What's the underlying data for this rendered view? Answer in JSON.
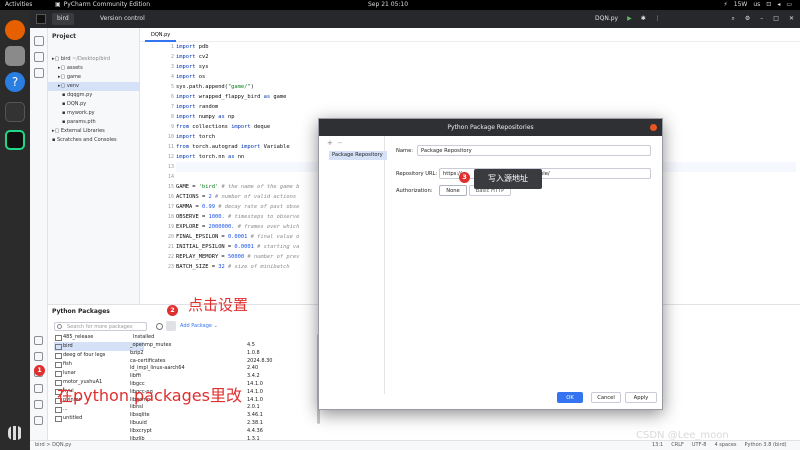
{
  "topbar": {
    "activities": "Activities",
    "app": "PyCharm Community Edition",
    "clock": "Sep 21  05:10",
    "temp": "15W",
    "lang": "us"
  },
  "titlebar": {
    "project": "bird",
    "vcs": "Version control",
    "run_config": "DQN.py"
  },
  "project": {
    "header": "Project",
    "items": [
      {
        "label": "bird",
        "dim": " ~/Desktop/bird",
        "indent": 4
      },
      {
        "label": "assets",
        "indent": 10
      },
      {
        "label": "game",
        "indent": 10
      },
      {
        "label": "venv",
        "indent": 10,
        "selected": true
      },
      {
        "label": "dqqgm.py",
        "indent": 14
      },
      {
        "label": "DQN.py",
        "indent": 14
      },
      {
        "label": "mywork.py",
        "indent": 14
      },
      {
        "label": "params.pth",
        "indent": 14
      },
      {
        "label": "External Libraries",
        "indent": 4
      },
      {
        "label": "Scratches and Consoles",
        "indent": 4
      }
    ]
  },
  "editor": {
    "tab": "DQN.py",
    "lines": [
      [
        {
          "t": "import",
          "c": "kw"
        },
        {
          "t": " pdb"
        }
      ],
      [
        {
          "t": "import",
          "c": "kw"
        },
        {
          "t": " cv2"
        }
      ],
      [
        {
          "t": "import",
          "c": "kw"
        },
        {
          "t": " sys"
        }
      ],
      [
        {
          "t": "import",
          "c": "kw"
        },
        {
          "t": " os"
        }
      ],
      [
        {
          "t": "sys.path.append("
        },
        {
          "t": "\"game/\"",
          "c": "str"
        },
        {
          "t": ")"
        }
      ],
      [
        {
          "t": "import",
          "c": "kw"
        },
        {
          "t": " wrapped_flappy_bird "
        },
        {
          "t": "as",
          "c": "kw"
        },
        {
          "t": " game"
        }
      ],
      [
        {
          "t": "import",
          "c": "kw"
        },
        {
          "t": " random"
        }
      ],
      [
        {
          "t": "import",
          "c": "kw"
        },
        {
          "t": " numpy "
        },
        {
          "t": "as",
          "c": "kw"
        },
        {
          "t": " np"
        }
      ],
      [
        {
          "t": "from",
          "c": "kw"
        },
        {
          "t": " collections "
        },
        {
          "t": "import",
          "c": "kw"
        },
        {
          "t": " deque"
        }
      ],
      [
        {
          "t": "import",
          "c": "kw"
        },
        {
          "t": " torch"
        }
      ],
      [
        {
          "t": "from",
          "c": "kw"
        },
        {
          "t": " torch.autograd "
        },
        {
          "t": "import",
          "c": "kw"
        },
        {
          "t": " Variable"
        }
      ],
      [
        {
          "t": "import",
          "c": "kw"
        },
        {
          "t": " torch.nn "
        },
        {
          "t": "as",
          "c": "kw"
        },
        {
          "t": " nn"
        }
      ],
      [],
      [],
      [
        {
          "t": "GAME = "
        },
        {
          "t": "'bird'",
          "c": "str"
        },
        {
          "t": " "
        },
        {
          "t": "# the name of the game b",
          "c": "cm"
        }
      ],
      [
        {
          "t": "ACTIONS = "
        },
        {
          "t": "2",
          "c": "num"
        },
        {
          "t": " "
        },
        {
          "t": "# number of valid actions",
          "c": "cm"
        }
      ],
      [
        {
          "t": "GAMMA = "
        },
        {
          "t": "0.99",
          "c": "num"
        },
        {
          "t": " "
        },
        {
          "t": "# decay rate of past obse",
          "c": "cm"
        }
      ],
      [
        {
          "t": "OBSERVE = "
        },
        {
          "t": "1000.",
          "c": "num"
        },
        {
          "t": " "
        },
        {
          "t": "# timesteps to observe",
          "c": "cm"
        }
      ],
      [
        {
          "t": "EXPLORE = "
        },
        {
          "t": "2000000.",
          "c": "num"
        },
        {
          "t": " "
        },
        {
          "t": "# frames over which",
          "c": "cm"
        }
      ],
      [
        {
          "t": "FINAL_EPSILON = "
        },
        {
          "t": "0.0001",
          "c": "num"
        },
        {
          "t": " "
        },
        {
          "t": "# final value o",
          "c": "cm"
        }
      ],
      [
        {
          "t": "INITIAL_EPSILON = "
        },
        {
          "t": "0.0001",
          "c": "num"
        },
        {
          "t": " "
        },
        {
          "t": "# starting va",
          "c": "cm"
        }
      ],
      [
        {
          "t": "REPLAY_MEMORY = "
        },
        {
          "t": "50000",
          "c": "num"
        },
        {
          "t": " "
        },
        {
          "t": "# number of prev",
          "c": "cm"
        }
      ],
      [
        {
          "t": "BATCH_SIZE = "
        },
        {
          "t": "32",
          "c": "num"
        },
        {
          "t": " "
        },
        {
          "t": "# size of minibatch",
          "c": "cm"
        }
      ]
    ]
  },
  "packages": {
    "title": "Python Packages",
    "search_placeholder": "Search for more packages",
    "add_label": "Add Package ⌄",
    "envs": [
      "485_release",
      "bird",
      "deeg of four legs",
      "fish",
      "lunar",
      "motor_yushuA1",
      "nyui",
      "pyinfor",
      "...",
      "untitled"
    ],
    "installed_label": "Installed",
    "rows": [
      [
        "_openmp_mutex",
        "4.5"
      ],
      [
        "bzip2",
        "1.0.8"
      ],
      [
        "ca-certificates",
        "2024.8.30"
      ],
      [
        "ld_impl_linux-aarch64",
        "2.40"
      ],
      [
        "libffi",
        "3.4.2"
      ],
      [
        "libgcc",
        "14.1.0"
      ],
      [
        "libgcc-ng",
        "14.1.0"
      ],
      [
        "libgomp",
        "14.1.0"
      ],
      [
        "libnsl",
        "2.0.1"
      ],
      [
        "libsqlite",
        "3.46.1"
      ],
      [
        "libuuid",
        "2.38.1"
      ],
      [
        "libxcrypt",
        "4.4.36"
      ],
      [
        "libzlib",
        "1.3.1"
      ]
    ]
  },
  "dialog": {
    "title": "Python Package Repositories",
    "item": "Package Repository",
    "name_label": "Name:",
    "name_value": "Package Repository",
    "url_label": "Repository URL:",
    "url_value": "https://",
    "url_tail": "ple/",
    "auth_label": "Authorization:",
    "auth_none": "None",
    "auth_basic": "Basic HTTP",
    "ok": "OK",
    "cancel": "Cancel",
    "apply": "Apply"
  },
  "annotations": {
    "b1": "1",
    "b2": "2",
    "b3": "3",
    "t1": "在python packages里改",
    "t2": "点击设置",
    "t3": "写入源地址"
  },
  "status": {
    "crumb": "bird  >  DQN.py",
    "right": [
      "13:1",
      "CRLF",
      "UTF-8",
      "4 spaces",
      "Python 3.8 (bird)"
    ]
  },
  "watermark": "CSDN @Lee_moon",
  "colors": {
    "accent": "#3574f0",
    "annotation": "#e02f2f"
  }
}
